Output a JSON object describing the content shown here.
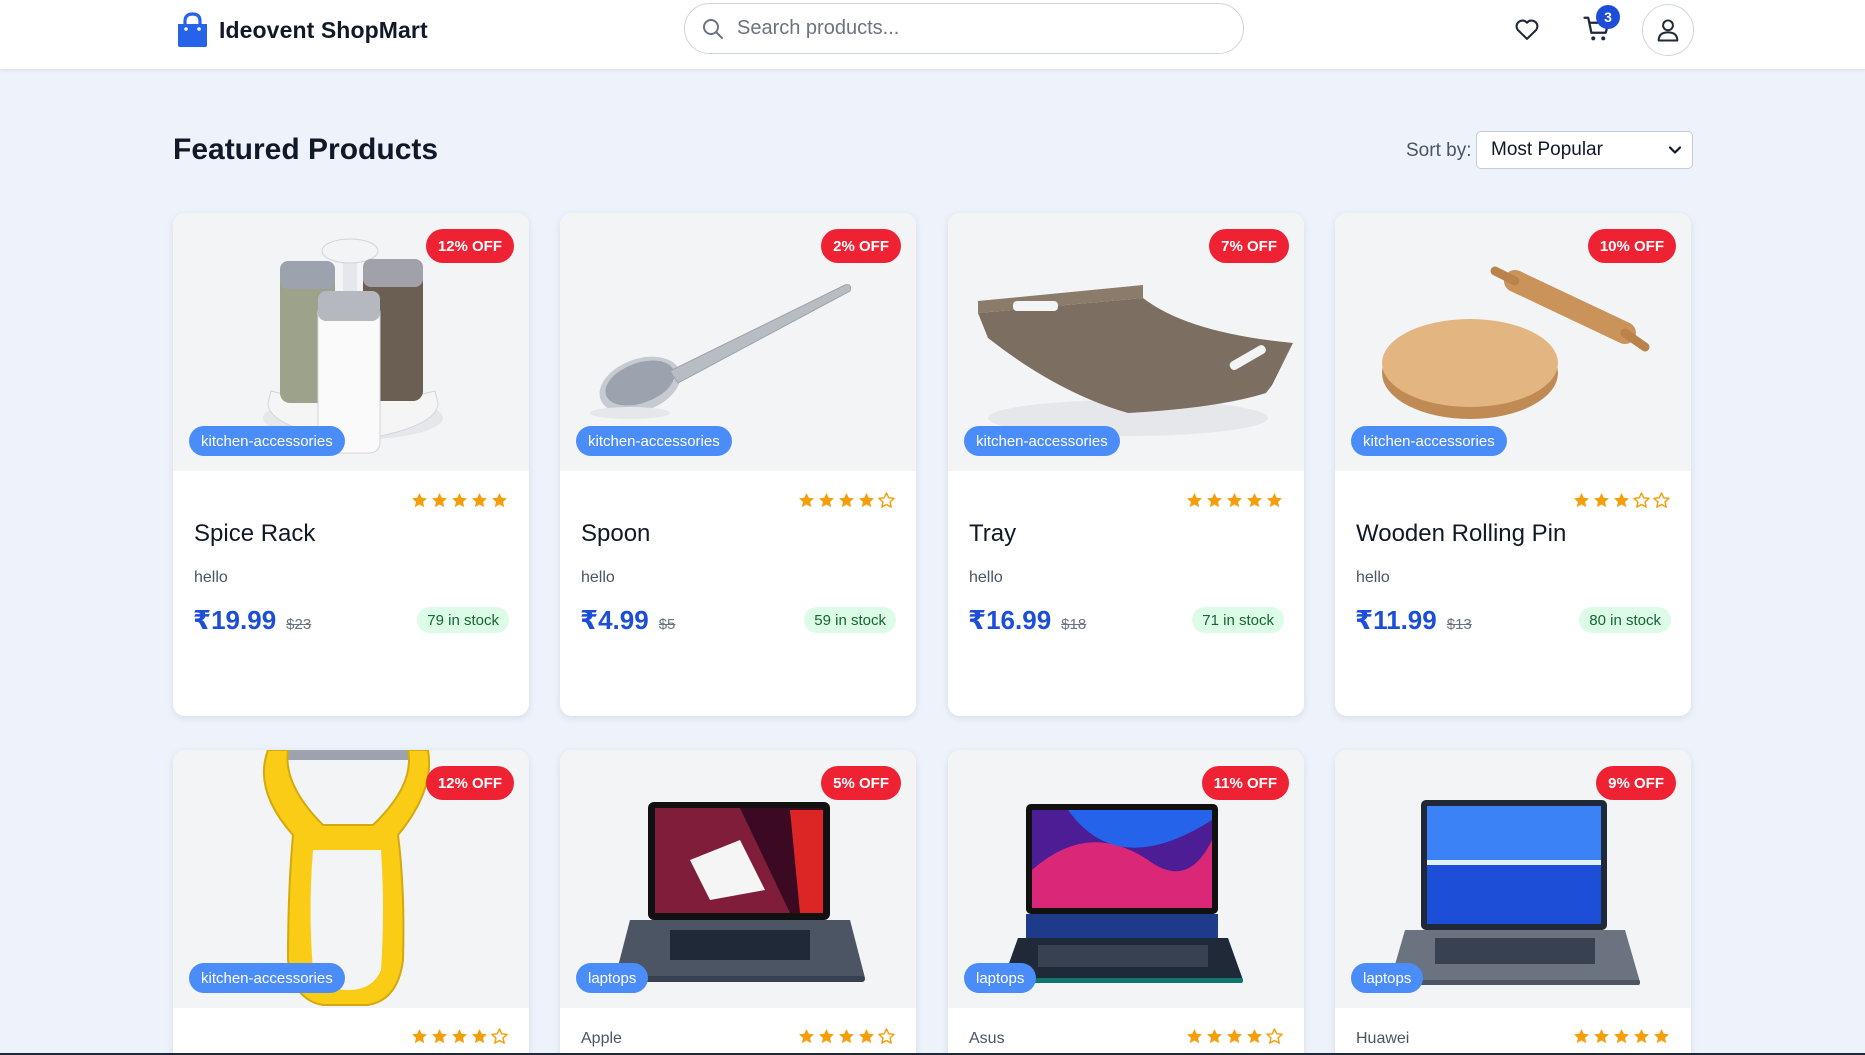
{
  "header": {
    "brand_name": "Ideovent ShopMart",
    "search_placeholder": "Search products...",
    "cart_count": "3"
  },
  "main": {
    "title": "Featured Products",
    "sort_label": "Sort by:",
    "sort_value": "Most Popular"
  },
  "colors": {
    "accent": "#1d4ed8",
    "discount": "#ef2233",
    "category": "#4b8df8",
    "stock_bg": "#dcfce7",
    "star": "#f59e0b"
  },
  "products": [
    {
      "name": "Spice Rack",
      "brand": "",
      "description": "hello",
      "price": "₹19.99",
      "old_price": "$23",
      "stock": "79 in stock",
      "discount": "12% OFF",
      "category": "kitchen-accessories",
      "rating": 5
    },
    {
      "name": "Spoon",
      "brand": "",
      "description": "hello",
      "price": "₹4.99",
      "old_price": "$5",
      "stock": "59 in stock",
      "discount": "2% OFF",
      "category": "kitchen-accessories",
      "rating": 4
    },
    {
      "name": "Tray",
      "brand": "",
      "description": "hello",
      "price": "₹16.99",
      "old_price": "$18",
      "stock": "71 in stock",
      "discount": "7% OFF",
      "category": "kitchen-accessories",
      "rating": 5
    },
    {
      "name": "Wooden Rolling Pin",
      "brand": "",
      "description": "hello",
      "price": "₹11.99",
      "old_price": "$13",
      "stock": "80 in stock",
      "discount": "10% OFF",
      "category": "kitchen-accessories",
      "rating": 3
    },
    {
      "name": "",
      "brand": "",
      "description": "",
      "price": "",
      "old_price": "",
      "stock": "",
      "discount": "12% OFF",
      "category": "kitchen-accessories",
      "rating": 4
    },
    {
      "name": "",
      "brand": "Apple",
      "description": "",
      "price": "",
      "old_price": "",
      "stock": "",
      "discount": "5% OFF",
      "category": "laptops",
      "rating": 4
    },
    {
      "name": "",
      "brand": "Asus",
      "description": "",
      "price": "",
      "old_price": "",
      "stock": "",
      "discount": "11% OFF",
      "category": "laptops",
      "rating": 4
    },
    {
      "name": "",
      "brand": "Huawei",
      "description": "",
      "price": "",
      "old_price": "",
      "stock": "",
      "discount": "9% OFF",
      "category": "laptops",
      "rating": 5
    }
  ]
}
